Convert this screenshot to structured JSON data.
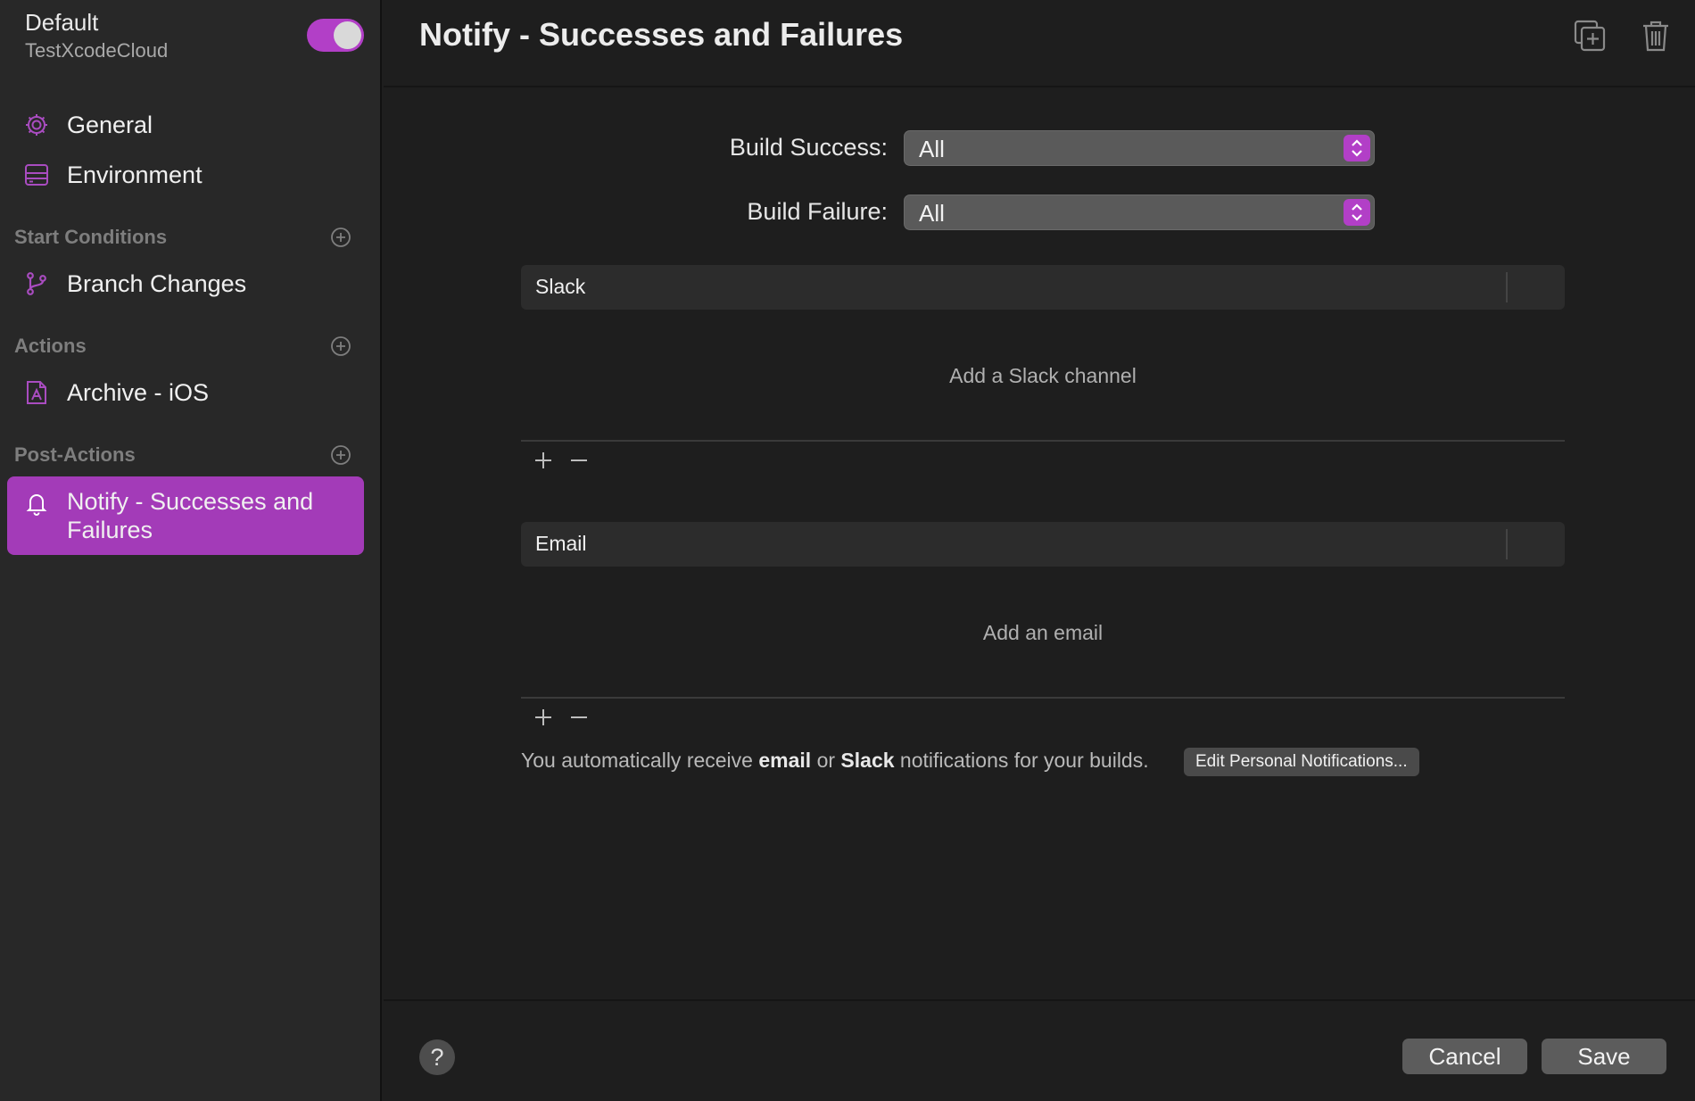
{
  "sidebar": {
    "workflow_name": "Default",
    "product_name": "TestXcodeCloud",
    "enabled": true,
    "items_top": [
      {
        "label": "General",
        "icon": "gear-icon"
      },
      {
        "label": "Environment",
        "icon": "server-icon"
      }
    ],
    "sections": [
      {
        "title": "Start Conditions",
        "items": [
          {
            "label": "Branch Changes",
            "icon": "branch-icon"
          }
        ]
      },
      {
        "title": "Actions",
        "items": [
          {
            "label": "Archive - iOS",
            "icon": "archive-icon"
          }
        ]
      },
      {
        "title": "Post-Actions",
        "items": [
          {
            "label": "Notify - Successes and Failures",
            "icon": "bell-icon"
          }
        ]
      }
    ]
  },
  "main": {
    "title": "Notify - Successes and Failures",
    "build_success_label": "Build Success:",
    "build_success_value": "All",
    "build_failure_label": "Build Failure:",
    "build_failure_value": "All",
    "slack": {
      "header": "Slack",
      "empty": "Add a Slack channel"
    },
    "email": {
      "header": "Email",
      "empty": "Add an email"
    },
    "info": {
      "pre": "You automatically receive",
      "email_word": "email",
      "or_word": "or",
      "slack_word": "Slack",
      "post": "notifications for your builds."
    },
    "edit_button": "Edit Personal Notifications..."
  },
  "footer": {
    "help": "?",
    "cancel": "Cancel",
    "save": "Save"
  },
  "colors": {
    "accent": "#a33bb8",
    "toggle": "#b23fc7",
    "background": "#1e1e1e",
    "sidebar": "#282828"
  }
}
